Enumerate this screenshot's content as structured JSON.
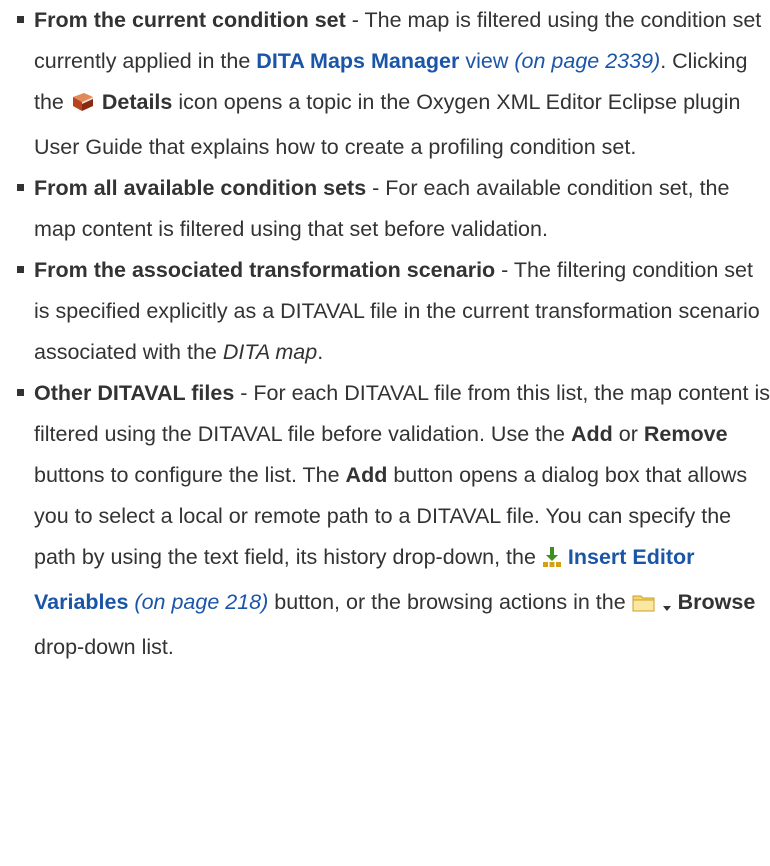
{
  "items": [
    {
      "term": "From the current condition set",
      "t1": " - The map is filtered using the condition set currently applied in the ",
      "link": "DITA Maps Manager",
      "link_after": " view",
      "xref": "(on page 2339)",
      "t2": ". Clicking the ",
      "icon": "book-icon",
      "button": "Details",
      "t3": " icon opens a topic in the Oxygen XML Editor Eclipse plugin User Guide that explains how to create a profiling condition set."
    },
    {
      "term": "From all available condition sets",
      "t1": " - For each available condition set, the map content is filtered using that set before validation."
    },
    {
      "term": "From the associated transformation scenario",
      "t1": " - The filtering condition set is specified explicitly as a DITAVAL file in the current transformation scenario associated with the ",
      "em": "DITA map",
      "t2": "."
    },
    {
      "term": "Other DITAVAL files",
      "t1": " - For each DITAVAL file from this list, the map content is filtered using the DITAVAL file before validation. Use the ",
      "add": "Add",
      "or": " or ",
      "remove": "Remove",
      "t2": " buttons to configure the list. The ",
      "add2": "Add",
      "t3": " button opens a dialog box that allows you to select a local or remote path to a DITAVAL file. You can specify the path by using the text field, its history drop-down, the ",
      "icon1": "insert-variable-icon",
      "link": "Insert Editor Variables",
      "xref": "(on page 218)",
      "t4": " button, or the browsing actions in the ",
      "icon2": "folder-icon",
      "icon3": "dropdown-arrow-icon",
      "browse": "Browse",
      "t5": " drop-down list."
    }
  ],
  "colors": {
    "text": "#333333",
    "link": "#1a55a8"
  }
}
